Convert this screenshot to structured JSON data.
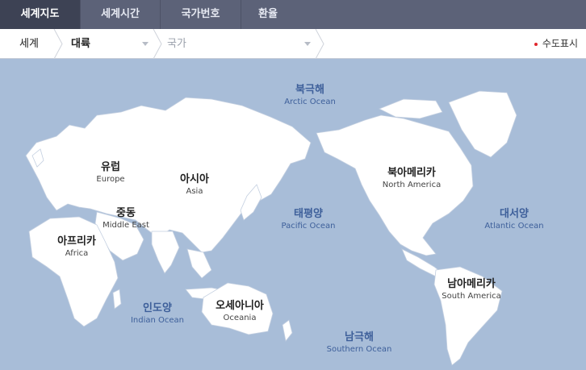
{
  "tabs": [
    {
      "label": "세계지도",
      "active": true
    },
    {
      "label": "세계시간",
      "active": false
    },
    {
      "label": "국가번호",
      "active": false
    },
    {
      "label": "환율",
      "active": false
    }
  ],
  "breadcrumb": {
    "world": "세계",
    "continent": "대륙",
    "country": "국가"
  },
  "capital_toggle": {
    "label": "수도표시",
    "dot_color": "#e0262c"
  },
  "colors": {
    "tab_bar": "#5c6278",
    "tab_active": "#3d4254",
    "ocean": "#a8bdd8",
    "land": "#ffffff",
    "ocean_label": "#3d5f9a"
  },
  "map": {
    "oceans": [
      {
        "ko": "북극해",
        "en": "Arctic Ocean"
      },
      {
        "ko": "태평양",
        "en": "Pacific Ocean"
      },
      {
        "ko": "대서양",
        "en": "Atlantic Ocean"
      },
      {
        "ko": "인도양",
        "en": "Indian Ocean"
      },
      {
        "ko": "남극해",
        "en": "Southern Ocean"
      }
    ],
    "continents": [
      {
        "ko": "유럽",
        "en": "Europe"
      },
      {
        "ko": "아시아",
        "en": "Asia"
      },
      {
        "ko": "중동",
        "en": "Middle East"
      },
      {
        "ko": "아프리카",
        "en": "Africa"
      },
      {
        "ko": "오세아니아",
        "en": "Oceania"
      },
      {
        "ko": "북아메리카",
        "en": "North America"
      },
      {
        "ko": "남아메리카",
        "en": "South America"
      }
    ]
  }
}
